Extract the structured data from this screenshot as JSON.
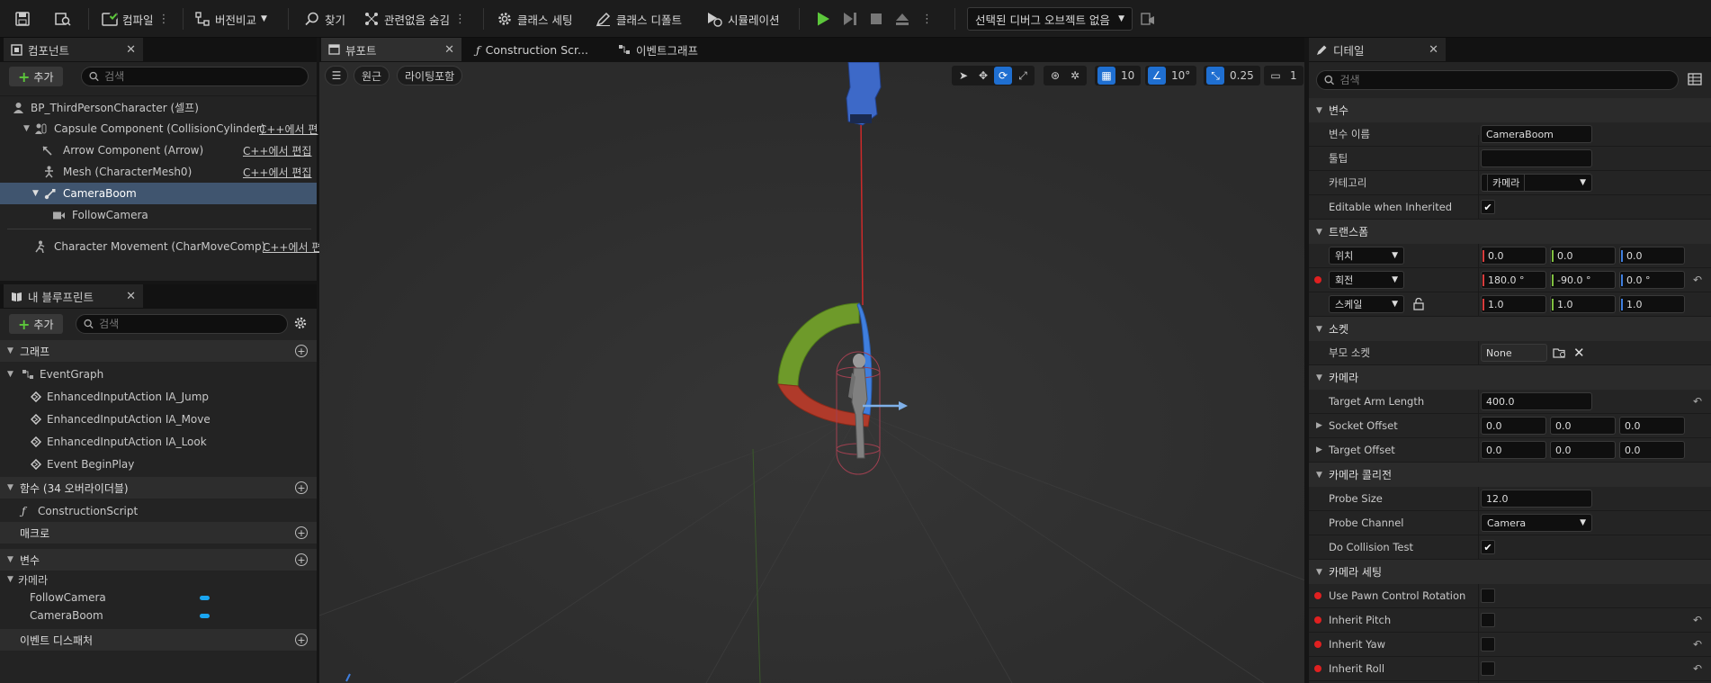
{
  "toolbar": {
    "compile": "컴파일",
    "diff": "버전비교",
    "find": "찾기",
    "hide_unrelated": "관련없음 숨김",
    "class_settings": "클래스 세팅",
    "class_defaults": "클래스 디폴트",
    "simulation": "시뮬레이션",
    "debug_object": "선택된 디버그 오브젝트 없음"
  },
  "components": {
    "tab": "컴포넌트",
    "add": "추가",
    "search_placeholder": "검색",
    "self": "BP_ThirdPersonCharacter (셀프)",
    "items": [
      {
        "label": "Capsule Component (CollisionCylinder)",
        "link": "C++에서 편"
      },
      {
        "label": "Arrow Component (Arrow)",
        "link": "C++에서 편집"
      },
      {
        "label": "Mesh (CharacterMesh0)",
        "link": "C++에서 편집"
      },
      {
        "label": "CameraBoom",
        "link": ""
      },
      {
        "label": "FollowCamera",
        "link": ""
      },
      {
        "label": "Character Movement (CharMoveComp)",
        "link": "C++에서 편"
      }
    ]
  },
  "blueprint": {
    "tab": "내 블루프린트",
    "add": "추가",
    "search_placeholder": "검색",
    "graph_section": "그래프",
    "event_graph": "EventGraph",
    "events": [
      "EnhancedInputAction IA_Jump",
      "EnhancedInputAction IA_Move",
      "EnhancedInputAction IA_Look",
      "Event BeginPlay"
    ],
    "functions_section": "함수 (34 오버라이더블)",
    "construction_script": "ConstructionScript",
    "macros_section": "매크로",
    "variables_section": "변수",
    "camera_category": "카메라",
    "variables": [
      "FollowCamera",
      "CameraBoom"
    ],
    "dispatchers_section": "이벤트 디스패처",
    "var_color": "#1aa5f0"
  },
  "center_tabs": {
    "viewport": "뷰포트",
    "construction": "Construction Scr...",
    "event_graph": "이벤트그래프"
  },
  "viewport": {
    "perspective": "원근",
    "lit": "라이팅포함",
    "grid_snap": "10",
    "rot_snap": "10°",
    "scale_snap": "0.25",
    "camera_speed": "1"
  },
  "details": {
    "tab": "디테일",
    "search_placeholder": "검색",
    "variables_section": "변수",
    "var_name_label": "변수 이름",
    "var_name_value": "CameraBoom",
    "tooltip_label": "툴팁",
    "tooltip_value": "",
    "category_label": "카테고리",
    "category_value": "카메라",
    "editable_label": "Editable when Inherited",
    "transform_section": "트랜스폼",
    "location_label": "위치",
    "location": [
      "0.0",
      "0.0",
      "0.0"
    ],
    "rotation_label": "회전",
    "rotation": [
      "180.0 °",
      "-90.0 °",
      "0.0 °"
    ],
    "scale_label": "스케일",
    "scale": [
      "1.0",
      "1.0",
      "1.0"
    ],
    "socket_section": "소켓",
    "parent_socket_label": "부모 소켓",
    "parent_socket_value": "None",
    "camera_section": "카메라",
    "target_arm_label": "Target Arm Length",
    "target_arm_value": "400.0",
    "socket_offset_label": "Socket Offset",
    "socket_offset": [
      "0.0",
      "0.0",
      "0.0"
    ],
    "target_offset_label": "Target Offset",
    "target_offset": [
      "0.0",
      "0.0",
      "0.0"
    ],
    "collision_section": "카메라 콜리전",
    "probe_size_label": "Probe Size",
    "probe_size_value": "12.0",
    "probe_channel_label": "Probe Channel",
    "probe_channel_value": "Camera",
    "do_collision_label": "Do Collision Test",
    "camera_settings_section": "카메라 세팅",
    "use_pawn_label": "Use Pawn Control Rotation",
    "inherit_pitch_label": "Inherit Pitch",
    "inherit_yaw_label": "Inherit Yaw",
    "inherit_roll_label": "Inherit Roll"
  },
  "colors": {
    "accent_blue": "#1f6fd1",
    "play_green": "#5cc73b",
    "x_axis": "#d83c3c",
    "y_axis": "#7fbf3f",
    "z_axis": "#3f7fdf"
  }
}
